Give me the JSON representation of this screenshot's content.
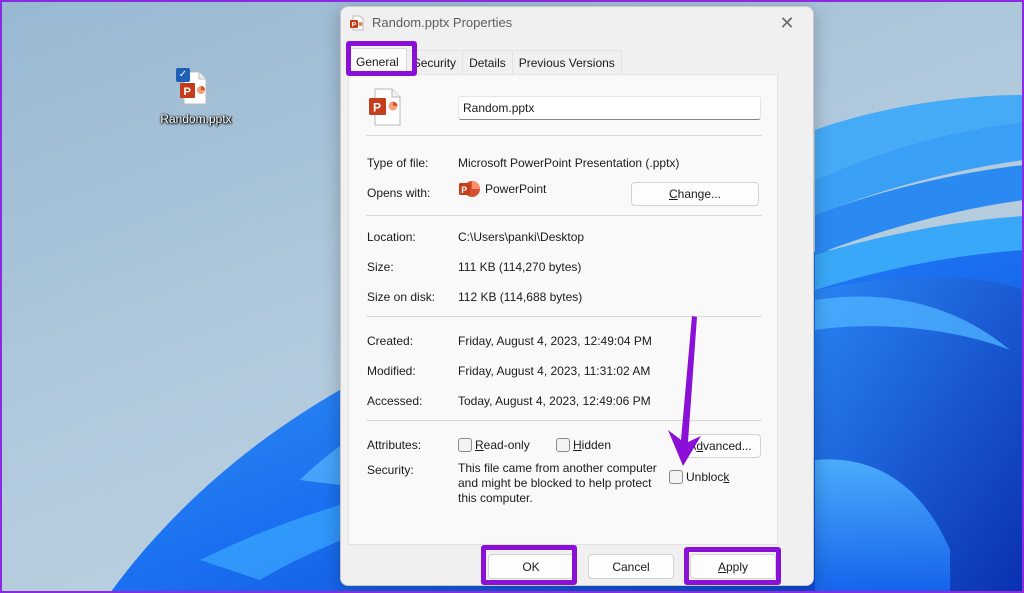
{
  "desktop": {
    "icon": {
      "label": "Random.pptx",
      "icon": "pptx-file-icon",
      "selected": true
    }
  },
  "dialog": {
    "title": "Random.pptx Properties",
    "close_icon": "close-icon",
    "tabs": [
      {
        "label": "General",
        "active": true
      },
      {
        "label": "Security",
        "active": false
      },
      {
        "label": "Details",
        "active": false
      },
      {
        "label": "Previous Versions",
        "active": false
      }
    ],
    "general": {
      "file_name": "Random.pptx",
      "type_label": "Type of file:",
      "type_value": "Microsoft PowerPoint Presentation (.pptx)",
      "opens_label": "Opens with:",
      "opens_value": "PowerPoint",
      "change_button": "Change...",
      "location_label": "Location:",
      "location_value": "C:\\Users\\panki\\Desktop",
      "size_label": "Size:",
      "size_value": "111 KB (114,270 bytes)",
      "size_disk_label": "Size on disk:",
      "size_disk_value": "112 KB (114,688 bytes)",
      "created_label": "Created:",
      "created_value": "Friday, August 4, 2023, 12:49:04 PM",
      "modified_label": "Modified:",
      "modified_value": "Friday, August 4, 2023, 11:31:02 AM",
      "accessed_label": "Accessed:",
      "accessed_value": "Today, August 4, 2023, 12:49:06 PM",
      "attributes_label": "Attributes:",
      "readonly": {
        "label": "Read-only",
        "checked": false
      },
      "hidden": {
        "label": "Hidden",
        "checked": false
      },
      "advanced_button": "Advanced...",
      "security_label": "Security:",
      "security_text": "This file came from another computer and might be blocked to help protect this computer.",
      "unblock": {
        "label": "Unblock",
        "checked": false
      }
    },
    "footer": {
      "ok": "OK",
      "cancel": "Cancel",
      "apply": "Apply"
    }
  },
  "annotations": {
    "highlight_color": "#8a10d8",
    "highlighted": [
      "General tab",
      "OK button",
      "Apply button"
    ],
    "arrow_target": "Unblock checkbox"
  }
}
